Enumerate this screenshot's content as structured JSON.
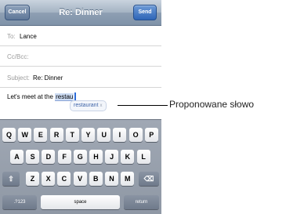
{
  "navbar": {
    "cancel_label": "Cancel",
    "title": "Re: Dinner",
    "send_label": "Send"
  },
  "fields": {
    "to_label": "To:",
    "to_value": "Lance",
    "cc_label": "Cc/Bcc:",
    "subject_label": "Subject:",
    "subject_value": "Re: Dinner"
  },
  "body": {
    "text_before": "Let's meet at the ",
    "current_word": "restau"
  },
  "suggestion": {
    "word": "restaurant",
    "close_symbol": "x"
  },
  "callout": {
    "label": "Proponowane słowo"
  },
  "keyboard": {
    "row1": [
      "Q",
      "W",
      "E",
      "R",
      "T",
      "Y",
      "U",
      "I",
      "O",
      "P"
    ],
    "row2": [
      "A",
      "S",
      "D",
      "F",
      "G",
      "H",
      "J",
      "K",
      "L"
    ],
    "row3": [
      "Z",
      "X",
      "C",
      "V",
      "B",
      "N",
      "M"
    ],
    "numbers_label": ".?123",
    "space_label": "space",
    "return_label": "return",
    "shift_icon": "shift-icon",
    "backspace_icon": "backspace-icon"
  }
}
